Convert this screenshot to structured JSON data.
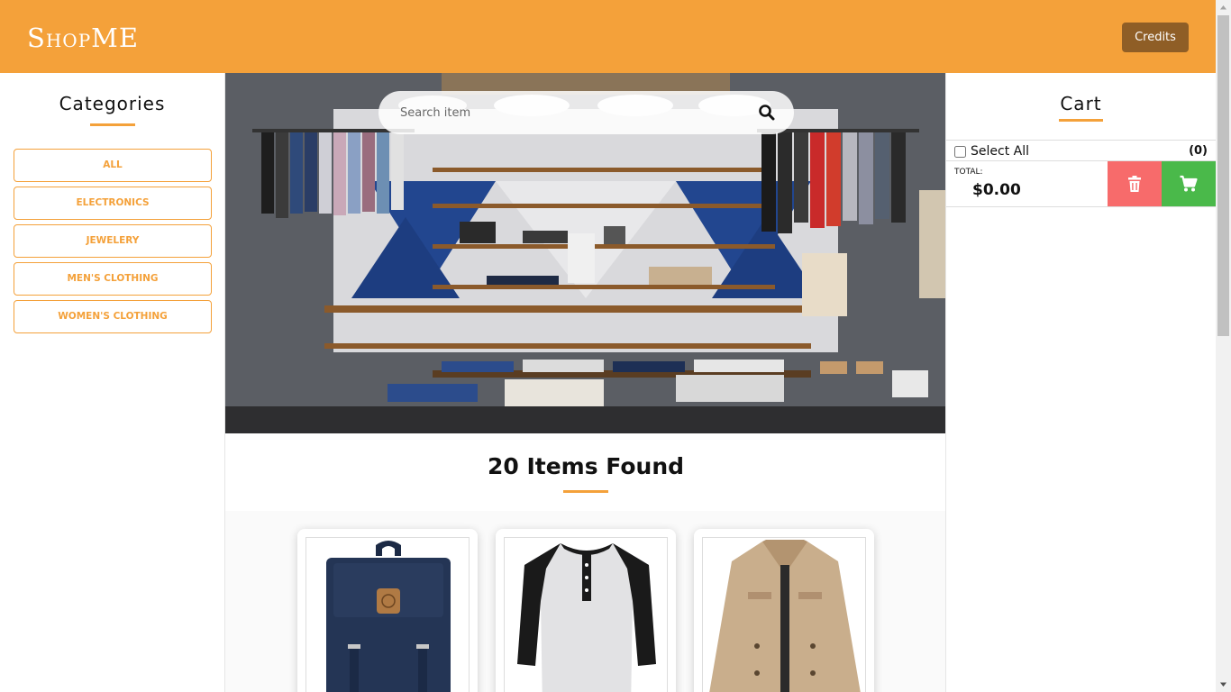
{
  "header": {
    "logo": "ShopME",
    "credits_label": "Credits",
    "brand_color": "#f4a13a"
  },
  "sidebar": {
    "title": "Categories",
    "categories": [
      "ALL",
      "ELECTRONICS",
      "JEWELERY",
      "MEN'S CLOTHING",
      "WOMEN'S CLOTHING"
    ]
  },
  "search": {
    "placeholder": "Search item",
    "value": "",
    "icon": "search-icon"
  },
  "results": {
    "title": "20 Items Found"
  },
  "products": [
    {
      "image": "backpack"
    },
    {
      "image": "raglan-henley-shirt"
    },
    {
      "image": "jacket"
    }
  ],
  "cart": {
    "title": "Cart",
    "select_all_label": "Select All",
    "select_all_checked": false,
    "count": "(0)",
    "total_label": "TOTAL:",
    "total_value": "$0.00",
    "delete_icon": "trash-icon",
    "checkout_icon": "cart-icon",
    "delete_color": "#f76b6b",
    "checkout_color": "#4ab94a"
  }
}
